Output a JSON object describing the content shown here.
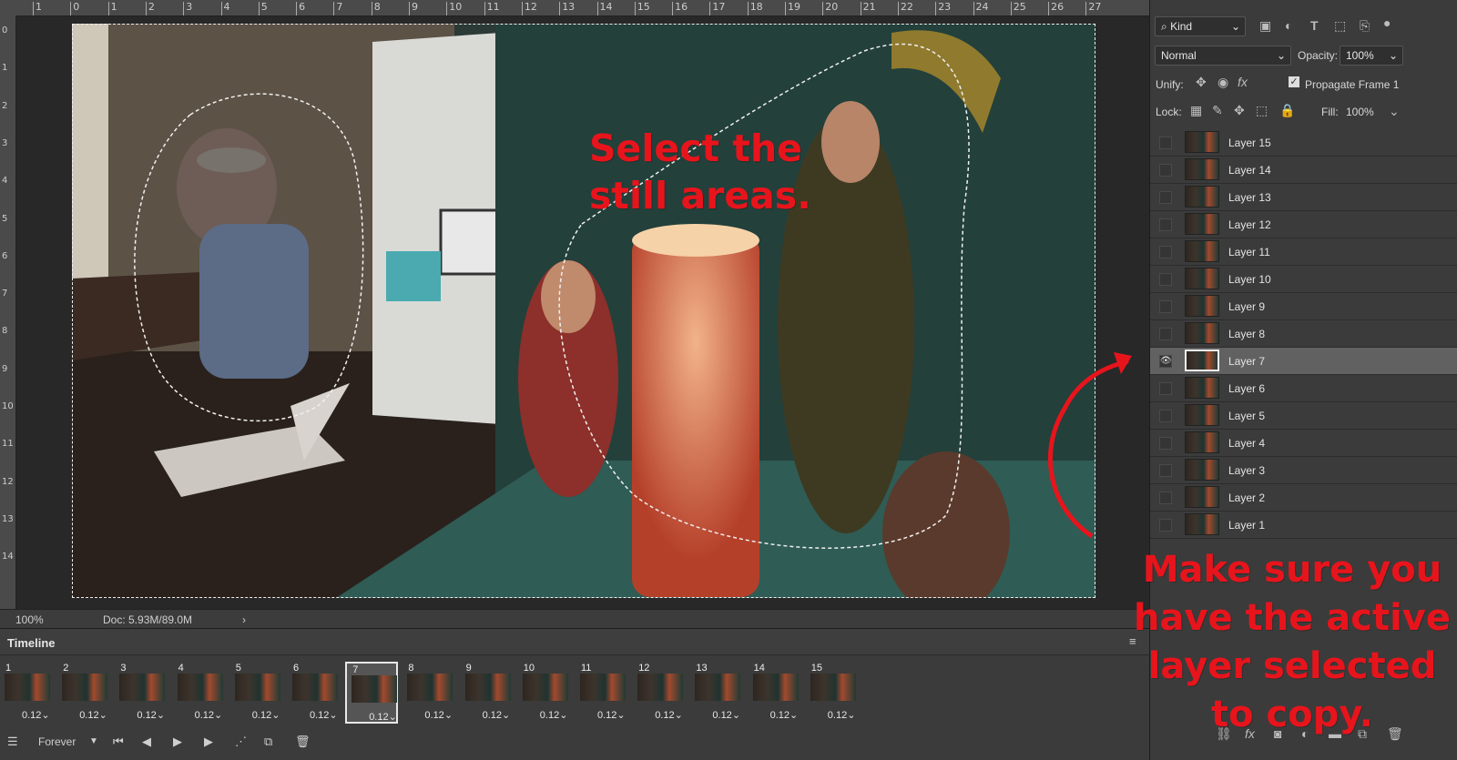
{
  "ruler": {
    "top_ticks": [
      "1",
      "0",
      "1",
      "2",
      "3",
      "4",
      "5",
      "6",
      "7",
      "8",
      "9",
      "10",
      "11",
      "12",
      "13",
      "14",
      "15",
      "16",
      "17",
      "18",
      "19",
      "20",
      "21",
      "22",
      "23",
      "24",
      "25",
      "26",
      "27"
    ],
    "left_ticks": [
      "0",
      "1",
      "2",
      "3",
      "4",
      "5",
      "6",
      "7",
      "8",
      "9",
      "10",
      "11",
      "12",
      "13",
      "14"
    ]
  },
  "annotations": {
    "select_line1": "Select the",
    "select_line2": "still areas.",
    "make_line1": "Make sure you",
    "make_line2": "have the active",
    "make_line3": "layer selected",
    "make_line4": "to copy."
  },
  "status": {
    "zoom": "100%",
    "doc": "Doc: 5.93M/89.0M",
    "arrow": "›"
  },
  "timeline": {
    "title": "Timeline",
    "frames": [
      {
        "num": "1",
        "dur": "0.12"
      },
      {
        "num": "2",
        "dur": "0.12"
      },
      {
        "num": "3",
        "dur": "0.12"
      },
      {
        "num": "4",
        "dur": "0.12"
      },
      {
        "num": "5",
        "dur": "0.12"
      },
      {
        "num": "6",
        "dur": "0.12"
      },
      {
        "num": "7",
        "dur": "0.12"
      },
      {
        "num": "8",
        "dur": "0.12"
      },
      {
        "num": "9",
        "dur": "0.12"
      },
      {
        "num": "10",
        "dur": "0.12"
      },
      {
        "num": "11",
        "dur": "0.12"
      },
      {
        "num": "12",
        "dur": "0.12"
      },
      {
        "num": "13",
        "dur": "0.12"
      },
      {
        "num": "14",
        "dur": "0.12"
      },
      {
        "num": "15",
        "dur": "0.12"
      }
    ],
    "selected_frame": 7,
    "loop": "Forever"
  },
  "panel": {
    "filter_kind": "Kind",
    "blend_mode": "Normal",
    "opacity_label": "Opacity:",
    "opacity_value": "100%",
    "unify_label": "Unify:",
    "propagate_label": "Propagate Frame 1",
    "lock_label": "Lock:",
    "fill_label": "Fill:",
    "fill_value": "100%",
    "layers": [
      "Layer 15",
      "Layer 14",
      "Layer 13",
      "Layer 12",
      "Layer 11",
      "Layer 10",
      "Layer 9",
      "Layer 8",
      "Layer 7",
      "Layer 6",
      "Layer 5",
      "Layer 4",
      "Layer 3",
      "Layer 2",
      "Layer 1"
    ],
    "active_layer": "Layer 7"
  },
  "colors": {
    "annotation": "#e8141c",
    "panel_bg": "#3b3b3b",
    "active_layer": "#616161"
  }
}
